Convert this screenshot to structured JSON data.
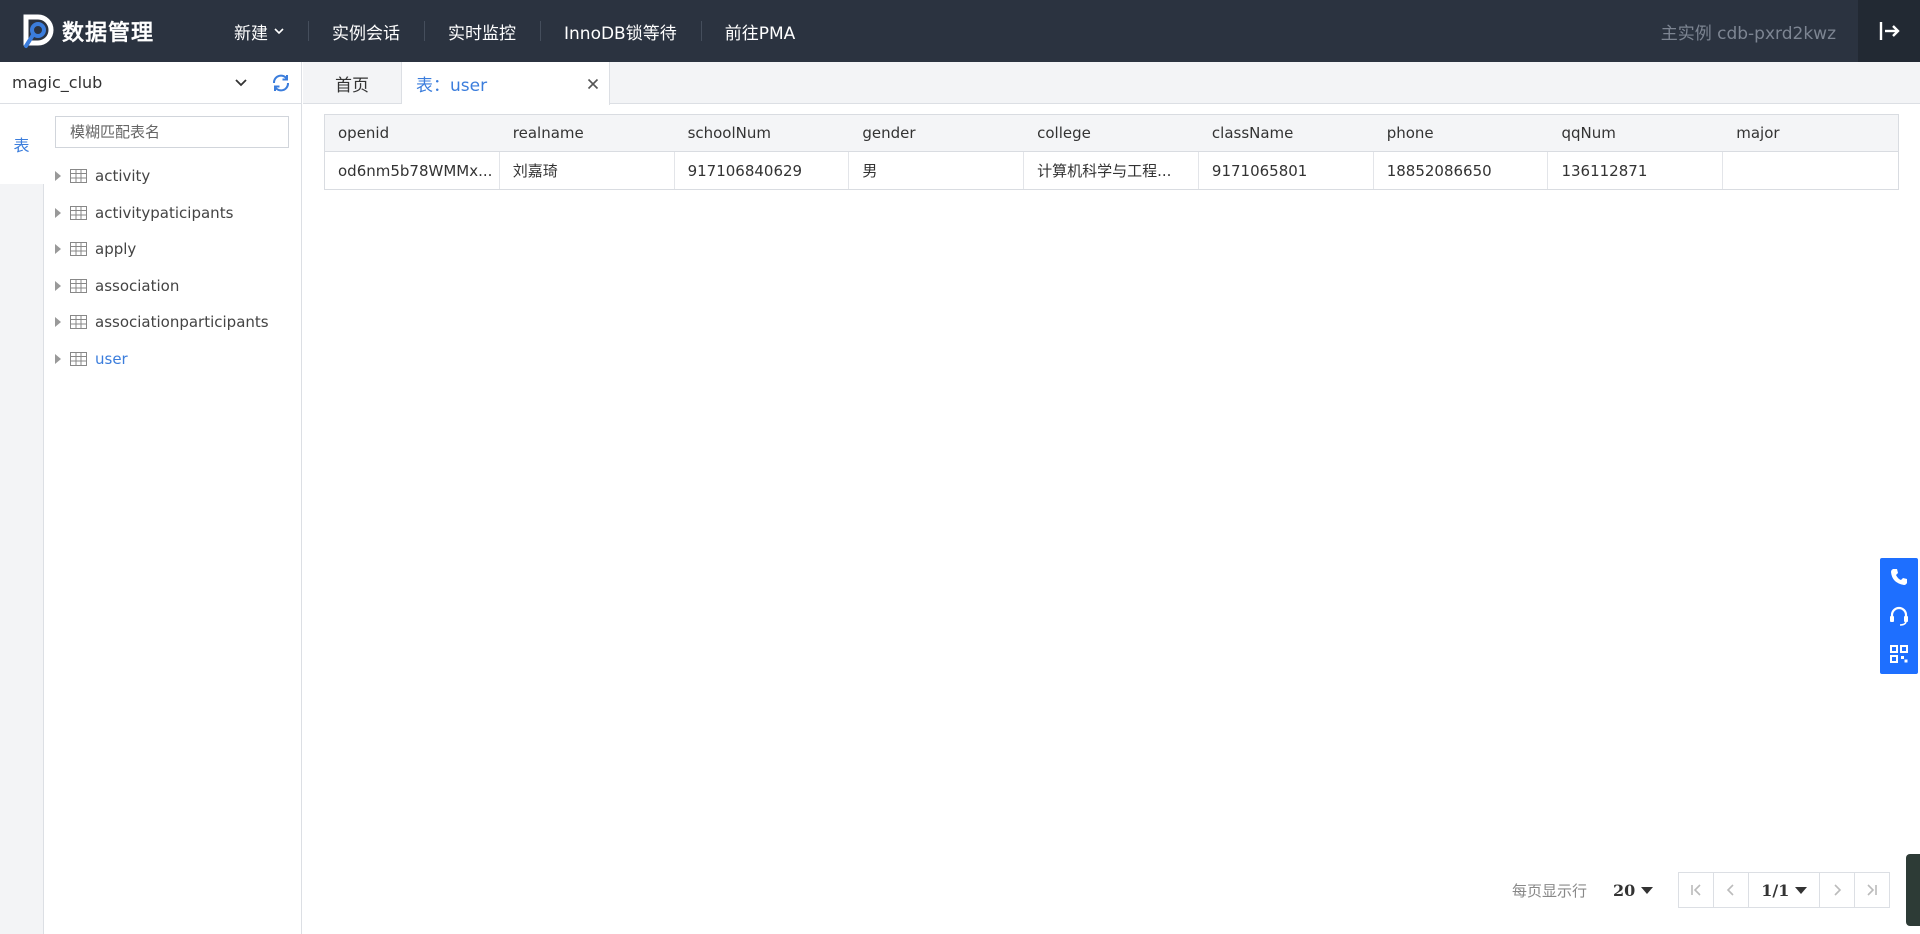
{
  "header": {
    "logo_text": "数据管理",
    "nav": [
      {
        "label": "新建",
        "dropdown": true
      },
      {
        "label": "实例会话"
      },
      {
        "label": "实时监控"
      },
      {
        "label": "InnoDB锁等待"
      },
      {
        "label": "前往PMA"
      }
    ],
    "instance_label": "主实例 cdb-pxrd2kwz"
  },
  "sidebar": {
    "database": "magic_club",
    "vertical_tab": "表",
    "search_placeholder": "模糊匹配表名",
    "tables": [
      {
        "label": "activity",
        "active": false
      },
      {
        "label": "activitypaticipants",
        "active": false
      },
      {
        "label": "apply",
        "active": false
      },
      {
        "label": "association",
        "active": false
      },
      {
        "label": "associationparticipants",
        "active": false
      },
      {
        "label": "user",
        "active": true
      }
    ]
  },
  "tabs": [
    {
      "label": "首页",
      "active": false
    },
    {
      "label": "表：user",
      "active": true,
      "closable": true
    }
  ],
  "grid": {
    "columns": [
      "openid",
      "realname",
      "schoolNum",
      "gender",
      "college",
      "className",
      "phone",
      "qqNum",
      "major"
    ],
    "rows": [
      [
        "od6nm5b78WMMx...",
        "刘嘉琦",
        "917106840629",
        "男",
        "计算机科学与工程...",
        "9171065801",
        "18852086650",
        "136112871",
        ""
      ]
    ]
  },
  "pagination": {
    "per_page_label": "每页显示行",
    "per_page": "20",
    "current": "1/1"
  },
  "colors": {
    "topbar": "#2b3340",
    "accent": "#3b7ddc",
    "float_panel": "#1e6fff"
  },
  "icons": [
    "logo-icon",
    "chevron-down-icon",
    "logout-icon",
    "refresh-icon",
    "table-icon",
    "close-icon",
    "first-page-icon",
    "prev-page-icon",
    "next-page-icon",
    "last-page-icon",
    "phone-icon",
    "headset-icon",
    "qrcode-icon"
  ]
}
